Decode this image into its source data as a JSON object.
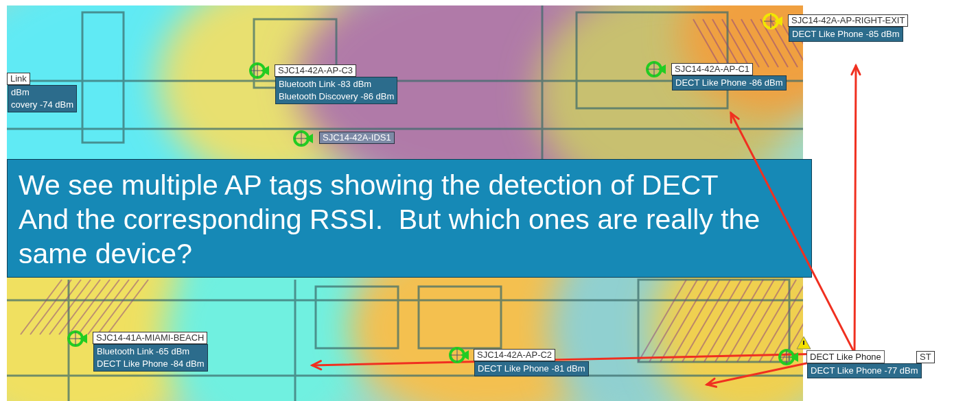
{
  "map": {
    "access_points": [
      {
        "tag": "Link",
        "readings": [
          "dBm",
          "covery -74 dBm"
        ]
      },
      {
        "name": "SJC14-42A-AP-C3",
        "color": "#22cc22",
        "readings": [
          "Bluetooth Link -83 dBm",
          "Bluetooth Discovery -86 dBm"
        ]
      },
      {
        "name": "SJC14-42A-IDS1",
        "color": "#22cc22",
        "kind": "monitor"
      },
      {
        "name": "SJC14-42A-AP-C1",
        "color": "#22cc22",
        "readings": [
          "DECT Like Phone -86 dBm"
        ]
      },
      {
        "name": "SJC14-42A-AP-RIGHT-EXIT",
        "color": "#f2e600",
        "readings": [
          "DECT Like Phone -85 dBm"
        ]
      },
      {
        "name": "SJC14-41A-MIAMI-BEACH",
        "color": "#22cc22",
        "readings": [
          "Bluetooth Link -65 dBm",
          "DECT Like Phone -84 dBm"
        ]
      },
      {
        "name": "SJC14-42A-AP-C2",
        "color": "#22cc22",
        "readings": [
          "DECT Like Phone -81 dBm"
        ]
      },
      {
        "name": "ST",
        "color": "#22cc22",
        "warning": true,
        "tooltip": "DECT Like Phone",
        "readings": [
          "DECT Like Phone -77 dBm"
        ]
      }
    ]
  },
  "callout": {
    "lines": [
      "We see multiple AP tags showing the detection of DECT",
      "And the corresponding RSSI.  But which ones are really the",
      "same device?"
    ]
  }
}
